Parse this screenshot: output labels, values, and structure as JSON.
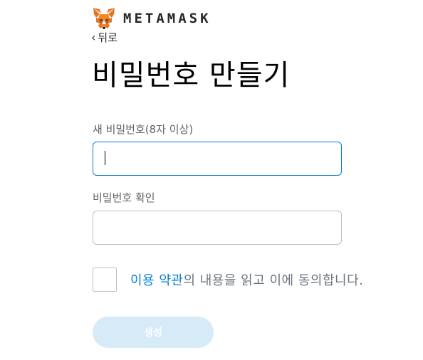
{
  "header": {
    "logo_icon": "metamask-fox-icon",
    "wordmark": "METAMASK"
  },
  "back": {
    "icon": "chevron-left-icon",
    "label": "뒤로"
  },
  "title": "비밀번호 만들기",
  "form": {
    "new_password": {
      "label": "새 비밀번호(8자 이상)",
      "value": ""
    },
    "confirm_password": {
      "label": "비밀번호 확인",
      "value": ""
    },
    "terms": {
      "link_text": "이용 약관",
      "rest_text": "의 내용을 읽고 이에 동의합니다.",
      "checked": false
    },
    "create_button": "생성"
  },
  "colors": {
    "accent": "#037dd6",
    "button_disabled": "#d6eaf8",
    "fox_orange": "#e2761b"
  }
}
